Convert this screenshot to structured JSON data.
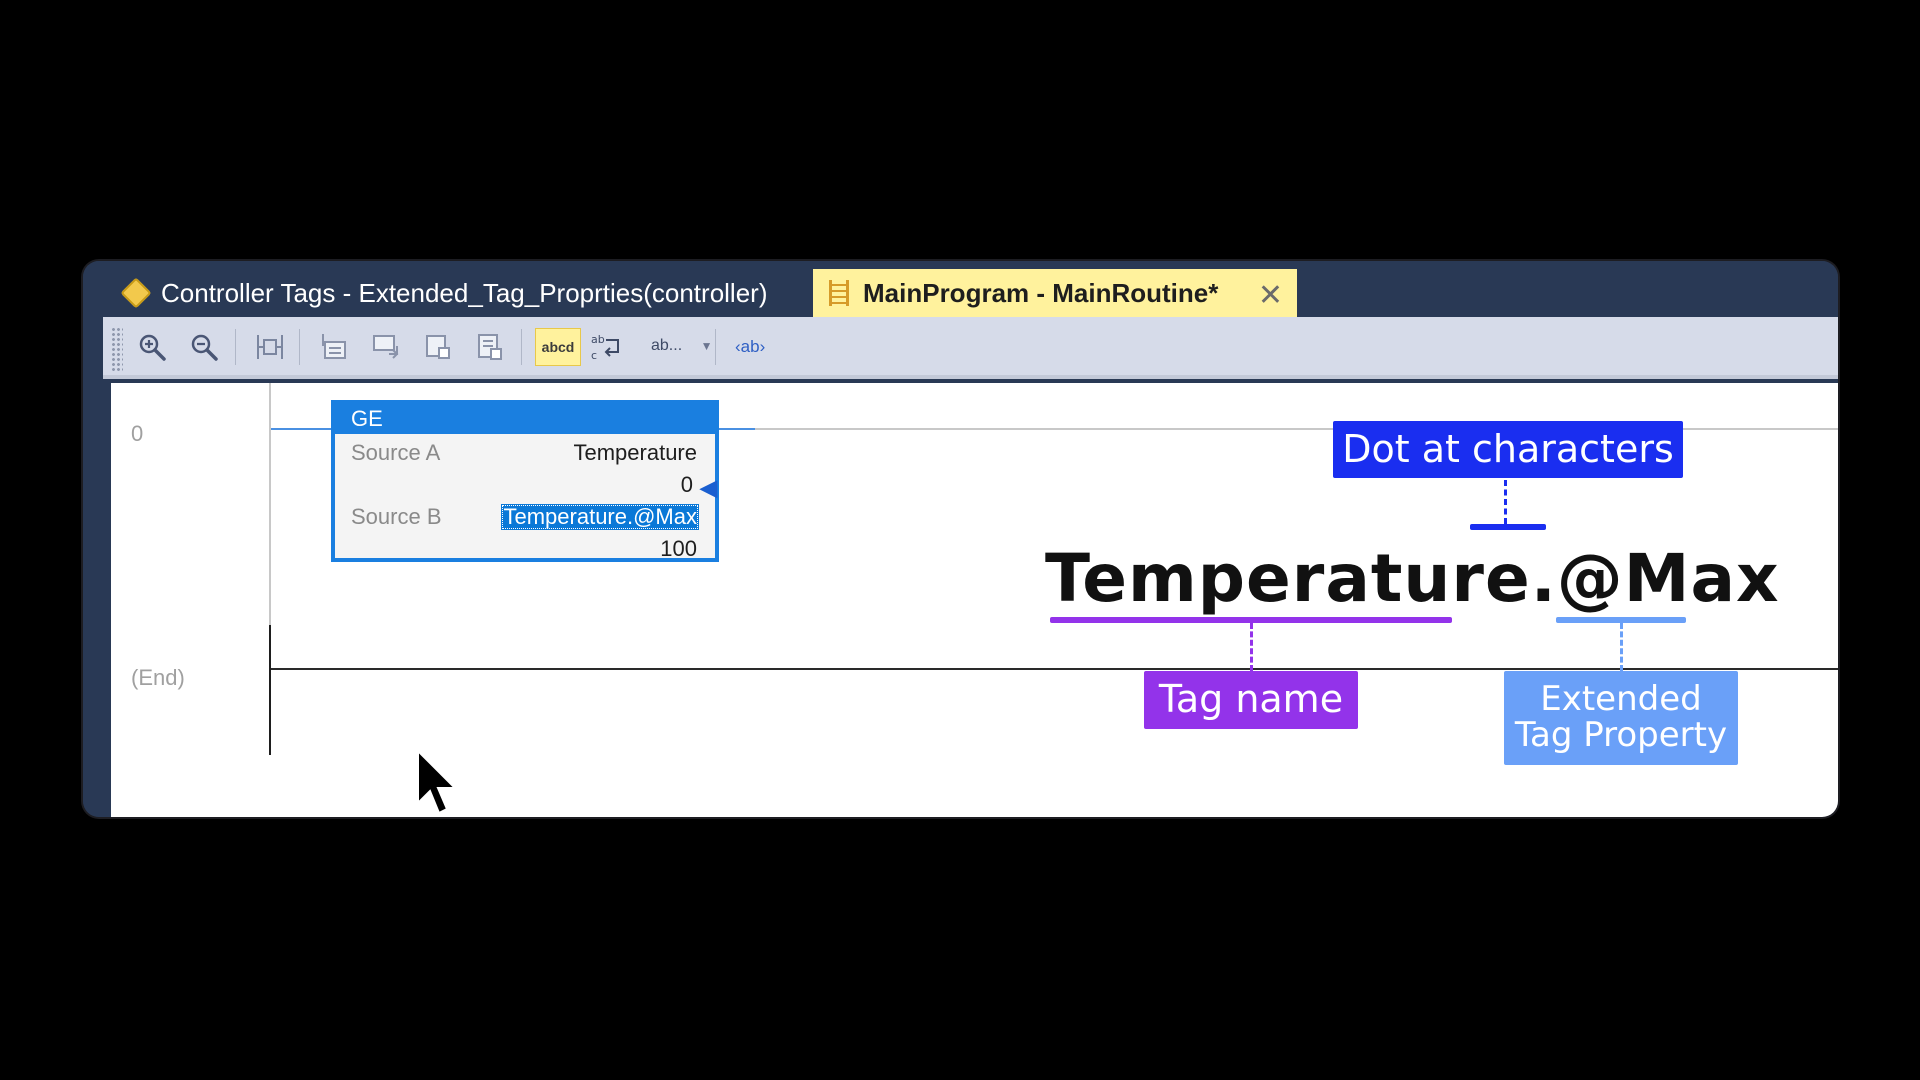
{
  "tabs": [
    {
      "label": "Controller Tags - Extended_Tag_Proprties(controller)",
      "icon": "tag-icon",
      "active": false
    },
    {
      "label": "MainProgram - MainRoutine*",
      "icon": "ladder-icon",
      "active": true
    }
  ],
  "tab_close": "✕",
  "toolbar": {
    "zoom_in": "zoom-in-icon",
    "zoom_out": "zoom-out-icon",
    "abcd_label": "abcd",
    "ab_dropdown_label": "ab...",
    "ab_tag_label": "‹ab›"
  },
  "rungs": {
    "rung0_number": "0",
    "end_label": "(End)"
  },
  "ge_block": {
    "title": "GE",
    "source_a_label": "Source A",
    "source_a_tag": "Temperature",
    "source_a_value": "0",
    "source_b_label": "Source B",
    "source_b_tag": "Temperature.@Max",
    "source_b_value": "100"
  },
  "annotation": {
    "tag_text": "Temperature.@Max",
    "dot_callout": "Dot at characters",
    "tag_name_callout": "Tag name",
    "extended_callout_line1": "Extended",
    "extended_callout_line2": "Tag Property"
  },
  "colors": {
    "tab_bar": "#293955",
    "active_tab": "#fff29d",
    "selection_blue": "#1a7fe0",
    "dot_callout": "#1a2ef0",
    "tag_name_callout": "#9333ea",
    "extended_callout": "#6aa0f8"
  }
}
